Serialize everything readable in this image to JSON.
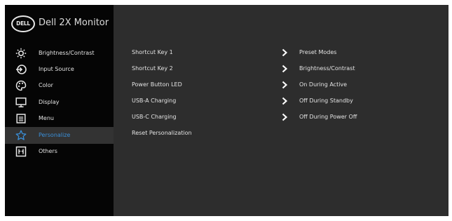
{
  "osd": {
    "logo_text": "DELL",
    "model_name": "Dell 2X Monitor"
  },
  "menu": [
    {
      "id": "brightness-contrast",
      "label": "Brightness/Contrast",
      "icon": "sun-icon",
      "active": false
    },
    {
      "id": "input-source",
      "label": "Input Source",
      "icon": "input-source-icon",
      "active": false
    },
    {
      "id": "color",
      "label": "Color",
      "icon": "palette-icon",
      "active": false
    },
    {
      "id": "display",
      "label": "Display",
      "icon": "monitor-icon",
      "active": false
    },
    {
      "id": "menu",
      "label": "Menu",
      "icon": "menu-icon",
      "active": false
    },
    {
      "id": "personalize",
      "label": "Personalize",
      "icon": "star-icon",
      "active": true
    },
    {
      "id": "others",
      "label": "Others",
      "icon": "others-icon",
      "active": false
    }
  ],
  "personalize": {
    "rows": [
      {
        "setting": "Shortcut Key 1",
        "value": "Preset Modes",
        "has_arrow": true
      },
      {
        "setting": "Shortcut Key 2",
        "value": "Brightness/Contrast",
        "has_arrow": true
      },
      {
        "setting": "Power Button LED",
        "value": "On During Active",
        "has_arrow": true
      },
      {
        "setting": "USB-A Charging",
        "value": "Off During Standby",
        "has_arrow": true
      },
      {
        "setting": "USB-C Charging",
        "value": "Off During Power Off",
        "has_arrow": true
      },
      {
        "setting": "Reset Personalization",
        "value": "",
        "has_arrow": false
      }
    ]
  },
  "colors": {
    "sidebar_bg": "#050505",
    "panel_bg": "#2d2d2d",
    "active_item_bg": "#333333",
    "active_text": "#3a8fd8",
    "text": "#e3e3e3"
  }
}
